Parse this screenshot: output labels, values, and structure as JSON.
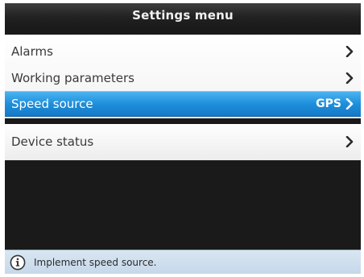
{
  "header": {
    "title": "Settings menu"
  },
  "menu": {
    "items": [
      {
        "label": "Alarms",
        "value": "",
        "icon": "chevron-right-icon"
      },
      {
        "label": "Working parameters",
        "value": "",
        "icon": "chevron-right-icon"
      },
      {
        "label": "Speed source",
        "value": "GPS",
        "icon": "chevron-right-icon",
        "selected": true
      }
    ]
  },
  "menu2": {
    "items": [
      {
        "label": "Device status",
        "value": "",
        "icon": "chevron-right-icon"
      }
    ]
  },
  "status": {
    "icon": "info-icon",
    "text": "Implement speed source."
  },
  "colors": {
    "selected_bg": "#1e8fdc",
    "header_bg": "#222222",
    "statusbar_bg": "#c5d8ea"
  }
}
